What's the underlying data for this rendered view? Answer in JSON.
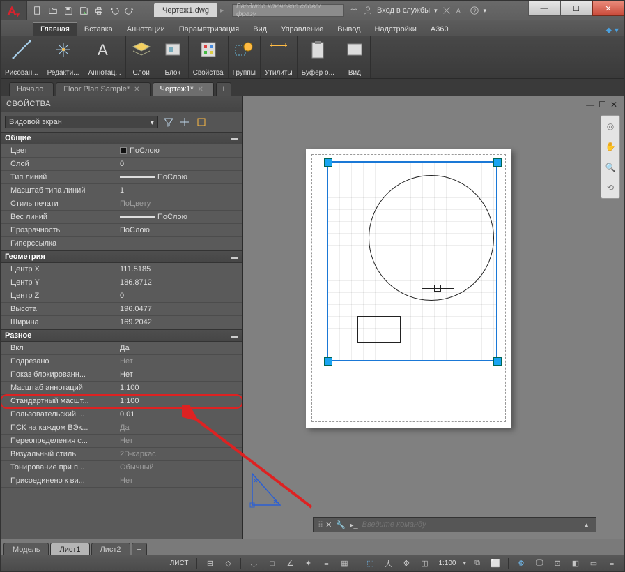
{
  "title_doc": "Чертеж1.dwg",
  "search_placeholder": "Введите ключевое слово/фразу",
  "signin_label": "Вход в службы",
  "ribbon_tabs": [
    "Главная",
    "Вставка",
    "Аннотации",
    "Параметризация",
    "Вид",
    "Управление",
    "Вывод",
    "Надстройки",
    "A360"
  ],
  "ribbon_panels": [
    "Рисован...",
    "Редакти...",
    "Аннотац...",
    "Слои",
    "Блок",
    "Свойства",
    "Группы",
    "Утилиты",
    "Буфер о...",
    "Вид"
  ],
  "doc_tabs": [
    {
      "label": "Начало",
      "active": false,
      "close": false
    },
    {
      "label": "Floor Plan Sample*",
      "active": false,
      "close": true
    },
    {
      "label": "Чертеж1*",
      "active": true,
      "close": true
    }
  ],
  "props": {
    "title": "СВОЙСТВА",
    "selector": "Видовой экран",
    "cat_general": "Общие",
    "general": [
      {
        "k": "Цвет",
        "v": "ПоСлою",
        "swatch": true
      },
      {
        "k": "Слой",
        "v": "0"
      },
      {
        "k": "Тип линий",
        "v": "ПоСлою",
        "line": true
      },
      {
        "k": "Масштаб типа линий",
        "v": "1"
      },
      {
        "k": "Стиль печати",
        "v": "ПоЦвету",
        "dim": true
      },
      {
        "k": "Вес линий",
        "v": "ПоСлою",
        "line": true
      },
      {
        "k": "Прозрачность",
        "v": "ПоСлою"
      },
      {
        "k": "Гиперссылка",
        "v": ""
      }
    ],
    "cat_geom": "Геометрия",
    "geom": [
      {
        "k": "Центр X",
        "v": "111.5185"
      },
      {
        "k": "Центр Y",
        "v": "186.8712"
      },
      {
        "k": "Центр Z",
        "v": "0"
      },
      {
        "k": "Высота",
        "v": "196.0477"
      },
      {
        "k": "Ширина",
        "v": "169.2042"
      }
    ],
    "cat_misc": "Разное",
    "misc": [
      {
        "k": "Вкл",
        "v": "Да"
      },
      {
        "k": "Подрезано",
        "v": "Нет",
        "dim": true
      },
      {
        "k": "Показ  блокированн...",
        "v": "Нет"
      },
      {
        "k": "Масштаб аннотаций",
        "v": "1:100"
      },
      {
        "k": "Стандартный  масшт...",
        "v": "1:100",
        "hl": true
      },
      {
        "k": "Пользовательский ...",
        "v": "0.01"
      },
      {
        "k": "ПСК на каждом ВЭк...",
        "v": "Да",
        "dim": true
      },
      {
        "k": "Переопределения  с...",
        "v": "Нет",
        "dim": true
      },
      {
        "k": "Визуальный стиль",
        "v": "2D-каркас",
        "dim": true
      },
      {
        "k": "Тонирование при п...",
        "v": "Обычный",
        "dim": true
      },
      {
        "k": "Присоединено к ви...",
        "v": "Нет",
        "dim": true
      }
    ]
  },
  "cmd_placeholder": "Введите команду",
  "layout_tabs": [
    {
      "label": "Модель",
      "active": false
    },
    {
      "label": "Лист1",
      "active": true
    },
    {
      "label": "Лист2",
      "active": false
    }
  ],
  "status": {
    "mode": "ЛИСТ",
    "scale": "1:100"
  }
}
